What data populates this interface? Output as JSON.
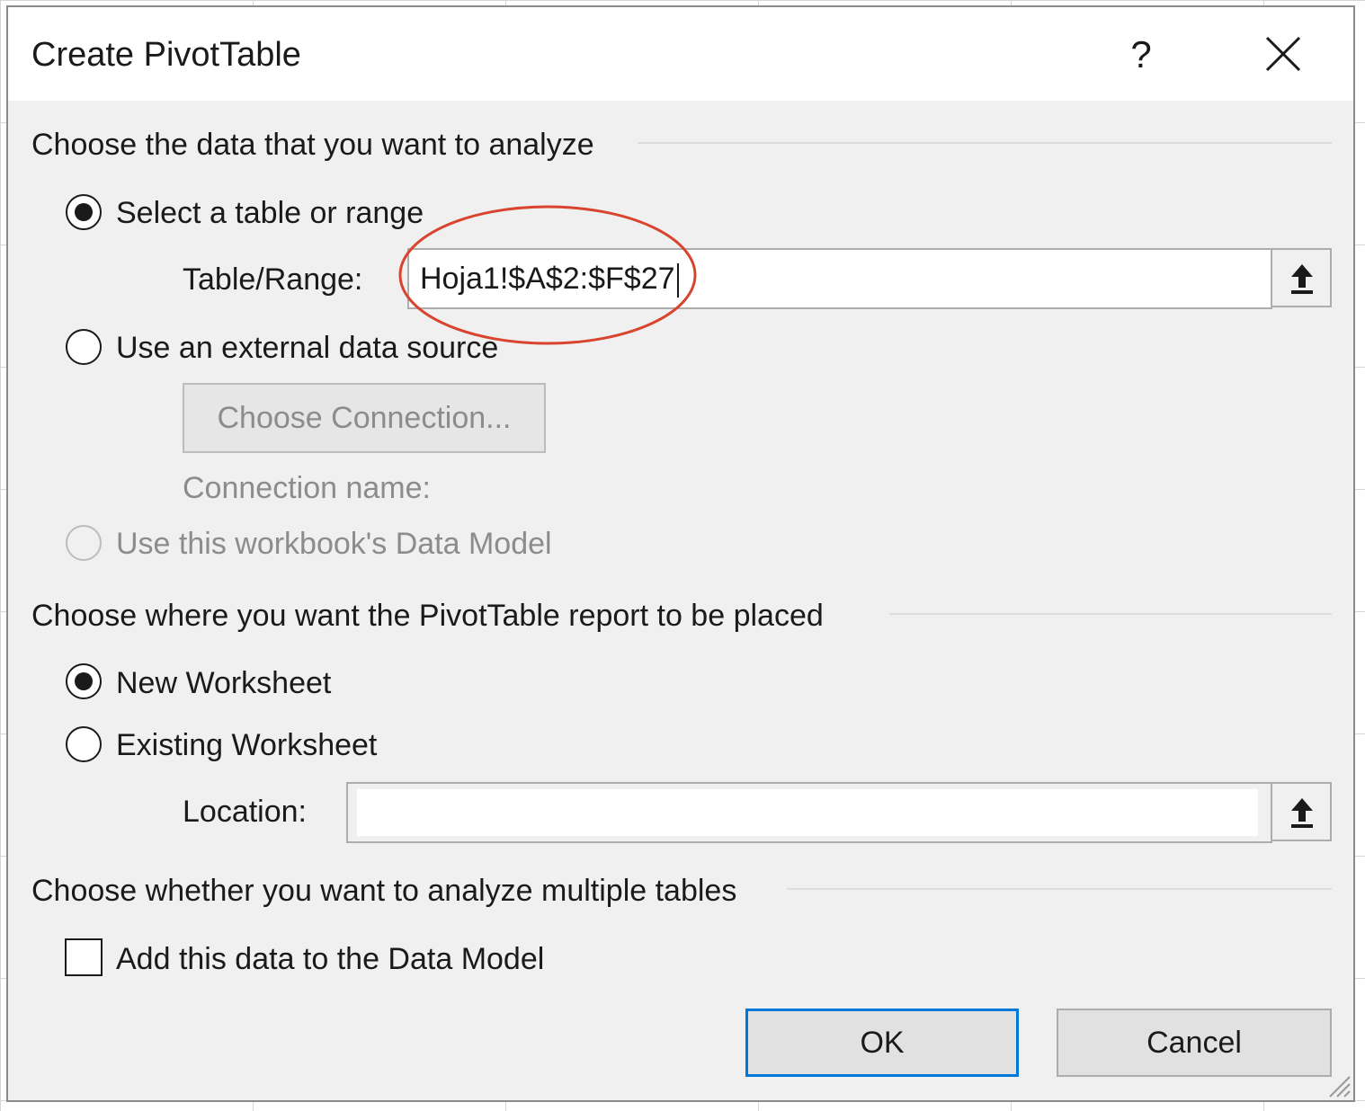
{
  "dialog": {
    "title": "Create PivotTable",
    "help_glyph": "?",
    "icons": {
      "help": "question-mark",
      "close": "x-close",
      "collapse": "up-arrow"
    }
  },
  "analyze_section": {
    "heading": "Choose the data that you want to analyze",
    "select_range": {
      "label": "Select a table or range",
      "checked": true
    },
    "table_range_label": "Table/Range:",
    "table_range_value": "Hoja1!$A$2:$F$27",
    "external_source": {
      "label": "Use an external data source",
      "checked": false
    },
    "choose_connection_label": "Choose Connection...",
    "connection_name_label": "Connection name:",
    "data_model": {
      "label": "Use this workbook's Data Model",
      "checked": false,
      "disabled": true
    }
  },
  "placement_section": {
    "heading": "Choose where you want the PivotTable report to be placed",
    "new_worksheet": {
      "label": "New Worksheet",
      "checked": true
    },
    "existing_worksheet": {
      "label": "Existing Worksheet",
      "checked": false
    },
    "location_label": "Location:",
    "location_value": ""
  },
  "multiple_section": {
    "heading": "Choose whether you want to analyze multiple tables",
    "add_to_model": {
      "label": "Add this data to the Data Model",
      "checked": false
    }
  },
  "buttons": {
    "ok": "OK",
    "cancel": "Cancel"
  },
  "colors": {
    "annotation_circle": "#d9442f",
    "default_button_border": "#0078d7",
    "dialog_bg": "#f0f0f0"
  }
}
